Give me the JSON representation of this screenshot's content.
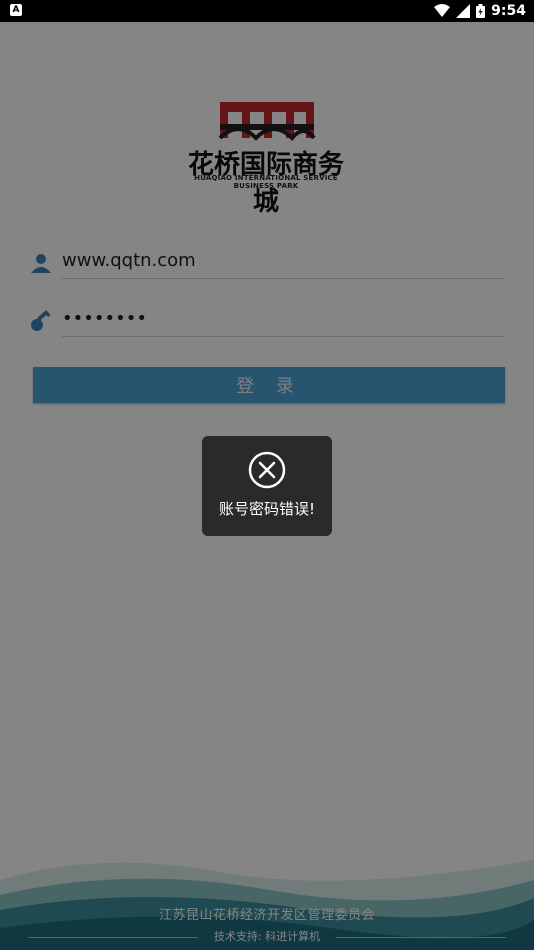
{
  "status_bar": {
    "time": "9:54",
    "left_icon_letter": "A"
  },
  "logo": {
    "title": "花桥国际商务城",
    "subtitle": "HUAQIAO INTERNATIONAL SERVICE BUSINESS PARK",
    "brand_colors": {
      "red": "#c2272d",
      "dark": "#222222"
    }
  },
  "form": {
    "username": "www.qqtn.com",
    "password_masked": "••••••••",
    "login_label": "登 录",
    "accent_color": "#4ba3d6"
  },
  "footer": {
    "organization": "江苏昆山花桥经济开发区管理委员会",
    "support": "技术支持: 科进计算机"
  },
  "toast": {
    "message": "账号密码错误!",
    "icon": "close-circle-icon"
  }
}
